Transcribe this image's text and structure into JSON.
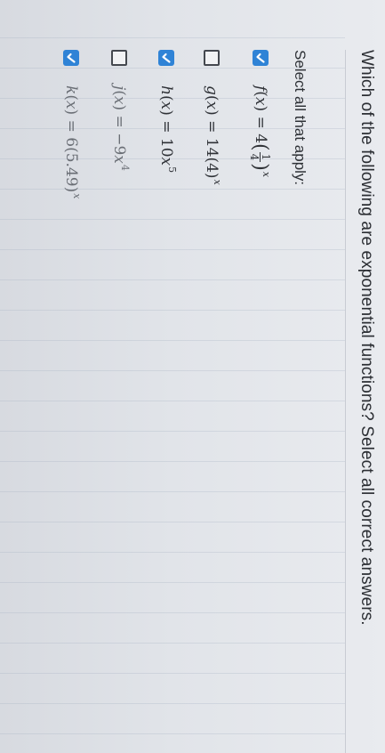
{
  "question": "Which of the following are exponential functions? Select all correct answers.",
  "prompt": "Select all that apply:",
  "options": [
    {
      "fname": "f",
      "var": "x",
      "checked": true
    },
    {
      "fname": "g",
      "var": "x",
      "checked": false
    },
    {
      "fname": "h",
      "var": "x",
      "checked": true
    },
    {
      "fname": "j",
      "var": "x",
      "checked": false
    },
    {
      "fname": "k",
      "var": "x",
      "checked": true
    }
  ],
  "formulas": {
    "f": {
      "coef": "4",
      "num": "1",
      "den": "4",
      "exp": "x"
    },
    "g": {
      "coef": "14",
      "base": "4",
      "exp": "x"
    },
    "h": {
      "coef": "10",
      "var": "x",
      "exp": "5"
    },
    "j": {
      "coef": "−9",
      "var": "x",
      "exp": "4"
    },
    "k": {
      "coef": "6",
      "base": "5.49",
      "exp": "x"
    }
  },
  "colors": {
    "checkbox_checked": "#2f83d6",
    "text": "#2e3136"
  }
}
